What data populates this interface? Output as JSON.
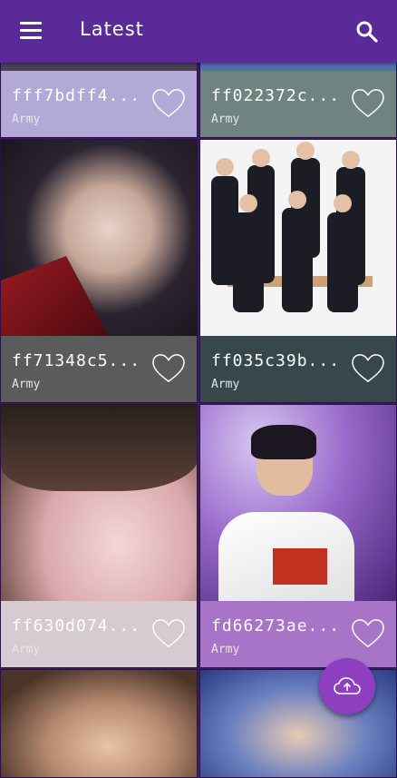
{
  "appbar": {
    "title": "Latest",
    "menu_icon": "menu-icon",
    "search_icon": "search-icon",
    "color": "#5b2a99"
  },
  "wallpapers": [
    {
      "id": "fff7bdff4...",
      "category": "Army",
      "info_color": "#b3a9d6"
    },
    {
      "id": "ff022372c...",
      "category": "Army",
      "info_color": "#6f8480"
    },
    {
      "id": "ff71348c5...",
      "category": "Army",
      "info_color": "#5b5b5b"
    },
    {
      "id": "ff035c39b...",
      "category": "Army",
      "info_color": "#38474c"
    },
    {
      "id": "ff630d074...",
      "category": "Army",
      "info_color": "#d6cbd0"
    },
    {
      "id": "fd66273ae...",
      "category": "Army",
      "info_color": "#a874c8"
    }
  ],
  "fab": {
    "icon": "cloud-upload-icon",
    "color": "#8d3fc0"
  }
}
